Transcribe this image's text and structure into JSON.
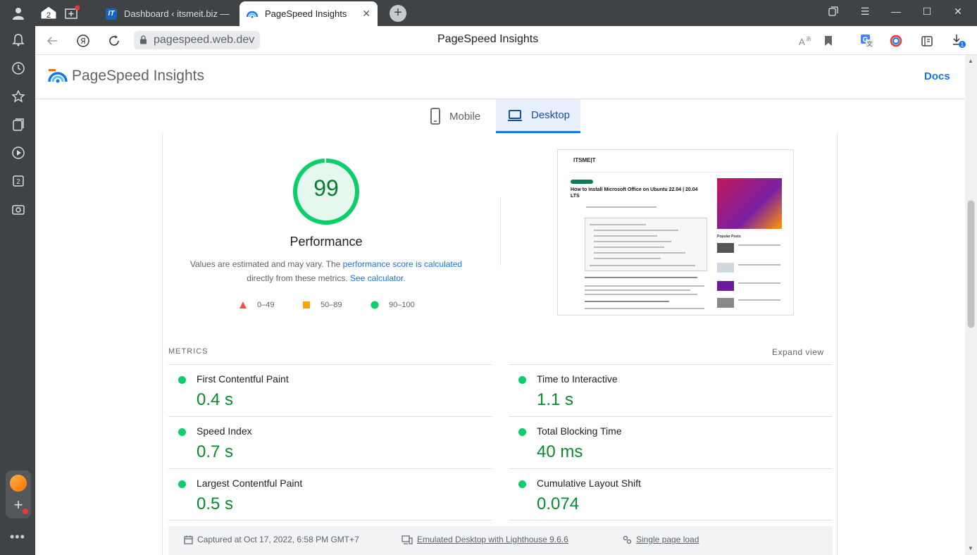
{
  "browser": {
    "tabs": [
      {
        "label": "Dashboard ‹ itsmeit.biz —",
        "active": false
      },
      {
        "label": "PageSpeed Insights",
        "active": true
      }
    ],
    "sidebar_badge": "2",
    "url": "pagespeed.web.dev",
    "page_title": "PageSpeed Insights",
    "downloads_badge": "1"
  },
  "header": {
    "app_name": "PageSpeed Insights",
    "docs_label": "Docs"
  },
  "device_tabs": [
    {
      "label": "Mobile",
      "active": false
    },
    {
      "label": "Desktop",
      "active": true
    }
  ],
  "performance": {
    "score": "99",
    "score_value": 0.99,
    "title": "Performance",
    "desc_prefix": "Values are estimated and may vary. The ",
    "desc_link1": "performance score is calculated",
    "desc_mid": "directly from these metrics. ",
    "desc_link2": "See calculator.",
    "legend": [
      {
        "label": "0–49",
        "color": "#ff4e42",
        "shape": "triangle"
      },
      {
        "label": "50–89",
        "color": "#ffa400",
        "shape": "square"
      },
      {
        "label": "90–100",
        "color": "#0cce6b",
        "shape": "circle"
      }
    ]
  },
  "screenshot": {
    "logo": "ITSME|T",
    "headline": "How to install Microsoft Office on Ubuntu 22.04 | 20.04 LTS",
    "popular_posts": "Popular Posts"
  },
  "metrics": {
    "title": "METRICS",
    "expand_label": "Expand view",
    "items": [
      {
        "name": "First Contentful Paint",
        "value": "0.4 s"
      },
      {
        "name": "Time to Interactive",
        "value": "1.1 s"
      },
      {
        "name": "Speed Index",
        "value": "0.7 s"
      },
      {
        "name": "Total Blocking Time",
        "value": "40 ms"
      },
      {
        "name": "Largest Contentful Paint",
        "value": "0.5 s"
      },
      {
        "name": "Cumulative Layout Shift",
        "value": "0.074"
      }
    ]
  },
  "info_bar": {
    "captured": "Captured at Oct 17, 2022, 6:58 PM GMT+7",
    "emulated": "Emulated Desktop with Lighthouse 9.6.6",
    "load": "Single page load"
  },
  "colors": {
    "accent": "#1a73e8",
    "good": "#0cce6b",
    "good_text": "#0a8a2e"
  }
}
